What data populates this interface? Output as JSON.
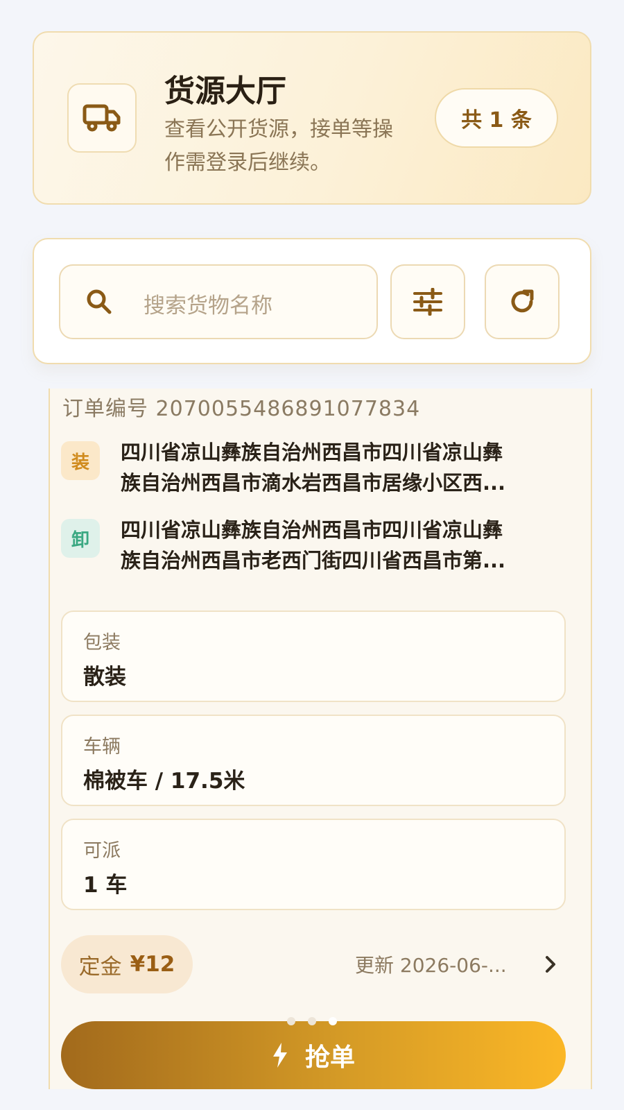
{
  "header": {
    "icon": "truck-icon",
    "title": "货源大厅",
    "description": "查看公开货源，接单等操作需登录后继续。",
    "count_badge": "共 1 条"
  },
  "search": {
    "placeholder": "搜索货物名称",
    "filter_icon": "sliders-icon",
    "refresh_icon": "refresh-icon"
  },
  "order": {
    "order_no": "订单编号 2070055486891077834",
    "load": {
      "tag": "装",
      "line1": "四川省凉山彝族自治州西昌市四川省凉山彝",
      "line2": "族自治州西昌市滴水岩西昌市居缘小区西..."
    },
    "unload": {
      "tag": "卸",
      "line1": "四川省凉山彝族自治州西昌市四川省凉山彝",
      "line2": "族自治州西昌市老西门街四川省西昌市第..."
    },
    "details": [
      {
        "label": "包装",
        "value": "散装"
      },
      {
        "label": "车辆",
        "value": "棉被车 / 17.5米"
      },
      {
        "label": "可派",
        "value": "1 车"
      }
    ],
    "deposit_label": "定金",
    "deposit_amount": "¥12",
    "updated": "更新 2026-06-...",
    "pagination": {
      "total": 3,
      "active": 3
    },
    "grab_button": "抢单"
  },
  "colors": {
    "accent": "#c08a22",
    "button_start": "#a26a1c",
    "button_end": "#fbb726",
    "load_tag": "#d08b1e",
    "unload_tag": "#3aa882"
  }
}
